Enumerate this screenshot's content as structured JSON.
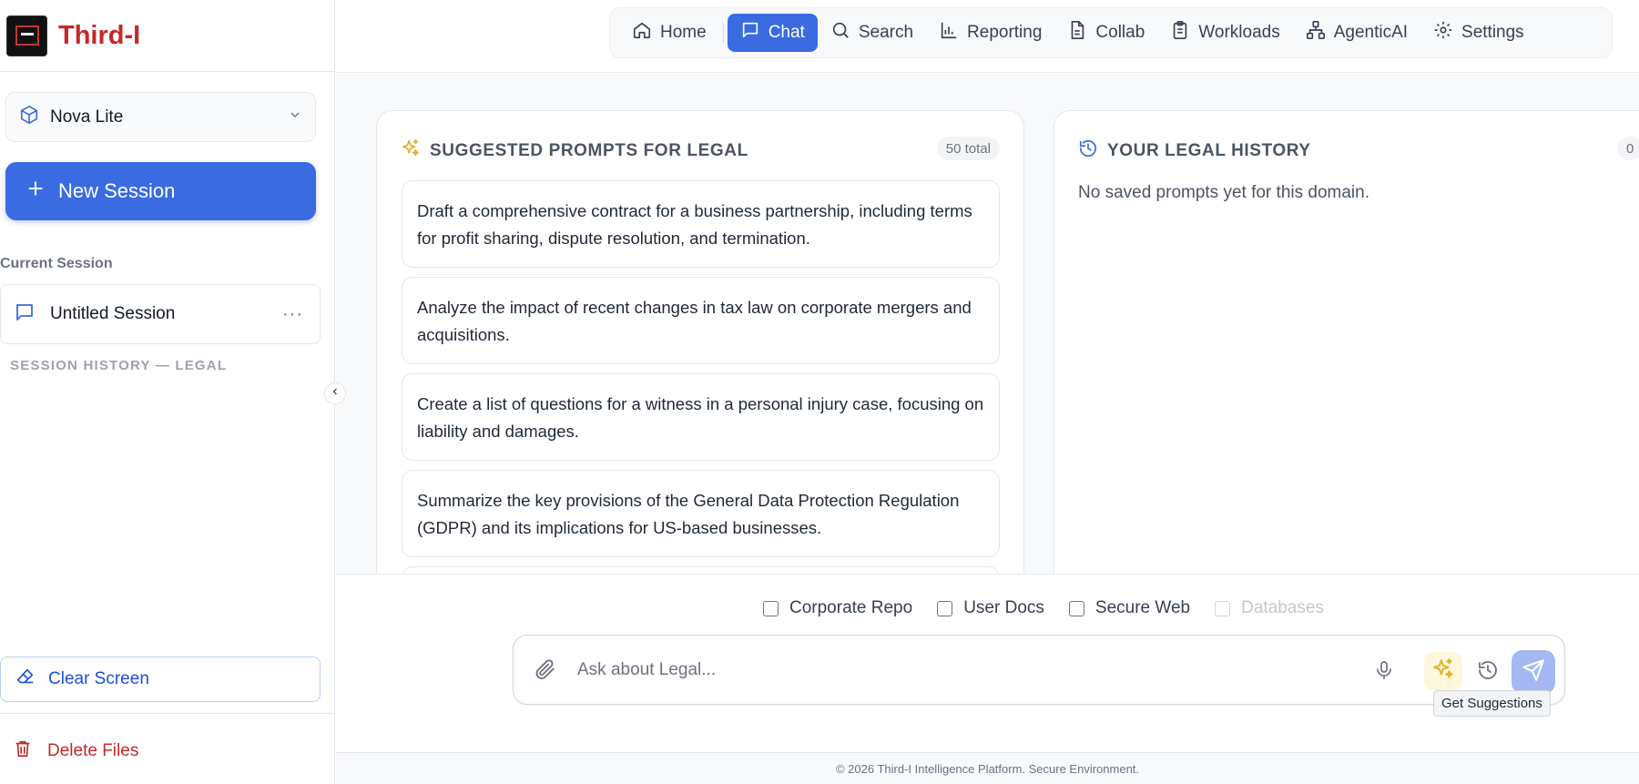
{
  "brand": {
    "name": "Third-I"
  },
  "sidebar": {
    "model_select": {
      "label": "Nova Lite"
    },
    "new_session_label": "New Session",
    "current_session_label": "Current Session",
    "current_session": {
      "title": "Untitled Session",
      "more": "···"
    },
    "session_history_label": "SESSION HISTORY — LEGAL",
    "clear_screen_label": "Clear Screen",
    "delete_files_label": "Delete Files"
  },
  "nav": {
    "items": [
      {
        "label": "Home",
        "icon": "home-icon"
      },
      {
        "label": "Chat",
        "icon": "chat-icon",
        "active": true
      },
      {
        "label": "Search",
        "icon": "search-icon"
      },
      {
        "label": "Reporting",
        "icon": "bar-chart-icon"
      },
      {
        "label": "Collab",
        "icon": "document-icon"
      },
      {
        "label": "Workloads",
        "icon": "clipboard-icon"
      },
      {
        "label": "AgenticAI",
        "icon": "network-icon"
      },
      {
        "label": "Settings",
        "icon": "gear-icon"
      }
    ]
  },
  "suggested": {
    "title": "SUGGESTED PROMPTS FOR LEGAL",
    "count": "50 total",
    "prompts": [
      "Draft a comprehensive contract for a business partnership, including terms for profit sharing, dispute resolution, and termination.",
      "Analyze the impact of recent changes in tax law on corporate mergers and acquisitions.",
      "Create a list of questions for a witness in a personal injury case, focusing on liability and damages.",
      "Summarize the key provisions of the General Data Protection Regulation (GDPR) and its implications for US-based businesses."
    ]
  },
  "history": {
    "title": "YOUR LEGAL HISTORY",
    "count": "0",
    "empty_text": "No saved prompts yet for this domain."
  },
  "composer": {
    "sources": [
      {
        "label": "Corporate Repo",
        "checked": false,
        "disabled": false
      },
      {
        "label": "User Docs",
        "checked": false,
        "disabled": false
      },
      {
        "label": "Secure Web",
        "checked": false,
        "disabled": false
      },
      {
        "label": "Databases",
        "checked": false,
        "disabled": true
      }
    ],
    "placeholder": "Ask about Legal...",
    "tooltip": "Get Suggestions"
  },
  "footer": {
    "text": "© 2026 Third-I Intelligence Platform. Secure Environment."
  },
  "colors": {
    "accent": "#3b6be0",
    "brand": "#c62828",
    "danger": "#c62828",
    "sparkle": "#e0b12a"
  }
}
